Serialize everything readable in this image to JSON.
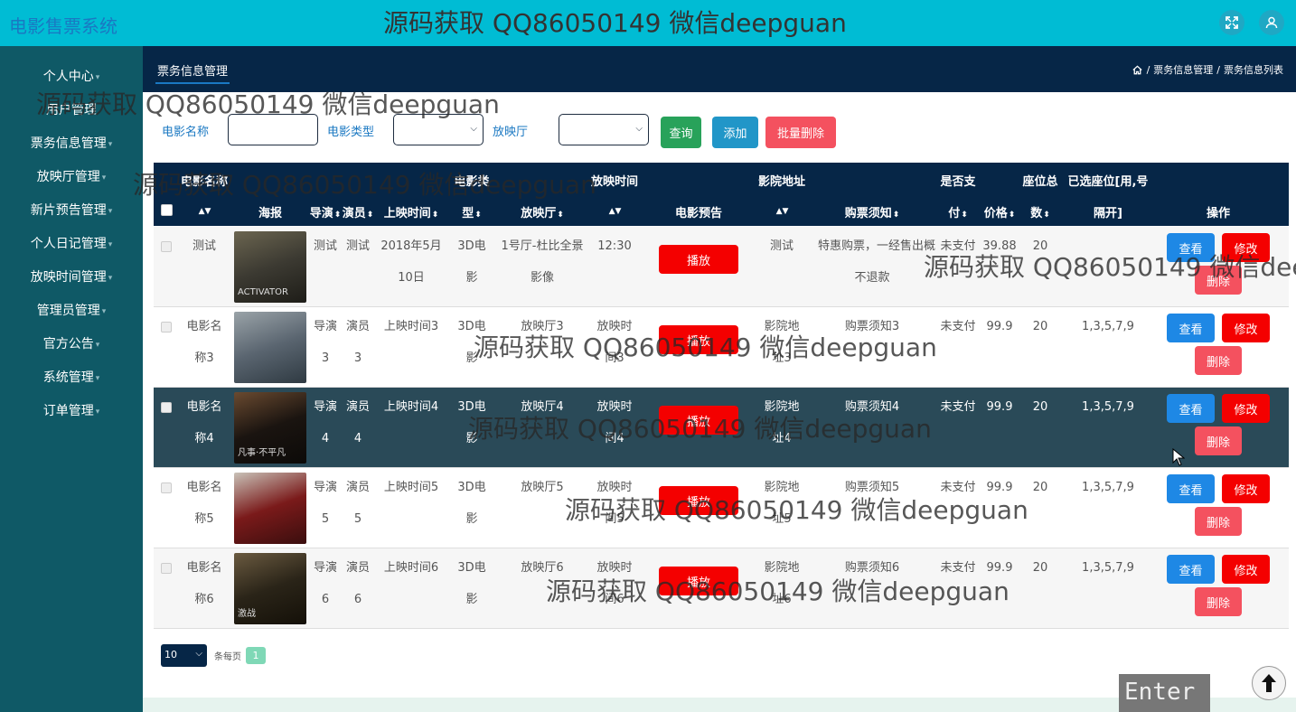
{
  "app": {
    "brand": "电影售票系统",
    "watermark": "源码获取 QQ86050149 微信deepguan"
  },
  "header_icons": [
    "fullscreen-icon",
    "user-icon"
  ],
  "sidebar": {
    "items": [
      "个人中心",
      "用户管理",
      "票务信息管理",
      "放映厅管理",
      "新片预告管理",
      "个人日记管理",
      "放映时间管理",
      "管理员管理",
      "官方公告",
      "系统管理",
      "订单管理"
    ]
  },
  "page": {
    "tab": "票务信息管理",
    "breadcrumb": {
      "sep": "/",
      "parts": [
        "票务信息管理",
        "票务信息列表"
      ]
    }
  },
  "search": {
    "movie_name_label": "电影名称",
    "movie_name_value": "",
    "movie_type_label": "电影类型",
    "hall_label": "放映厅",
    "query_btn": "查询",
    "add_btn": "添加",
    "batch_delete_btn": "批量删除"
  },
  "table": {
    "headers": {
      "name_top": "电影名称",
      "poster": "海报",
      "director": "导演",
      "actor": "演员",
      "release": "上映时间",
      "type_top": "电影类",
      "type_bottom": "型",
      "hall": "放映厅",
      "showtime": "放映时间",
      "trailer": "电影预告",
      "address": "影院地址",
      "notice": "购票须知",
      "paid_top": "是否支",
      "paid_bottom": "付",
      "price": "价格",
      "seats_top": "座位总",
      "seats_bottom": "数",
      "chosen_top": "已选座位[用,号",
      "chosen_bottom": "隔开]",
      "ops": "操作"
    },
    "play_label": "播放",
    "view_label": "查看",
    "edit_label": "修改",
    "delete_label": "删除",
    "rows": [
      {
        "name1": "测试",
        "name2": "",
        "director1": "测试",
        "director2": "",
        "actor1": "测试",
        "actor2": "",
        "release1": "2018年5月",
        "release2": "10日",
        "type1": "3D电",
        "type2": "影",
        "hall1": "1号厅-杜比全景",
        "hall2": "影像",
        "time1": "12:30",
        "time2": "",
        "addr1": "测试",
        "addr2": "",
        "notice1": "特惠购票，一经售出概",
        "notice2": "不退款",
        "paid": "未支付",
        "price": "39.88",
        "seats": "20",
        "chosen": "",
        "poster_text": "ACTIVATOR",
        "poster_colors": [
          "#3c3a32",
          "#6b6550",
          "#1e1d18"
        ],
        "selected": false
      },
      {
        "name1": "电影名",
        "name2": "称3",
        "director1": "导演",
        "director2": "3",
        "actor1": "演员",
        "actor2": "3",
        "release1": "上映时间3",
        "release2": "",
        "type1": "3D电",
        "type2": "影",
        "hall1": "放映厅3",
        "hall2": "",
        "time1": "放映时",
        "time2": "间3",
        "addr1": "影院地",
        "addr2": "址3",
        "notice1": "购票须知3",
        "notice2": "",
        "paid": "未支付",
        "price": "99.9",
        "seats": "20",
        "chosen": "1,3,5,7,9",
        "poster_text": "",
        "poster_colors": [
          "#5a6570",
          "#9aa3a8",
          "#2f3a42"
        ],
        "selected": false
      },
      {
        "name1": "电影名",
        "name2": "称4",
        "director1": "导演",
        "director2": "4",
        "actor1": "演员",
        "actor2": "4",
        "release1": "上映时间4",
        "release2": "",
        "type1": "3D电",
        "type2": "影",
        "hall1": "放映厅4",
        "hall2": "",
        "time1": "放映时",
        "time2": "间4",
        "addr1": "影院地",
        "addr2": "址4",
        "notice1": "购票须知4",
        "notice2": "",
        "paid": "未支付",
        "price": "99.9",
        "seats": "20",
        "chosen": "1,3,5,7,9",
        "poster_text": "凡事·不平凡",
        "poster_colors": [
          "#1a1410",
          "#6a4a30",
          "#0c0a08"
        ],
        "selected": true
      },
      {
        "name1": "电影名",
        "name2": "称5",
        "director1": "导演",
        "director2": "5",
        "actor1": "演员",
        "actor2": "5",
        "release1": "上映时间5",
        "release2": "",
        "type1": "3D电",
        "type2": "影",
        "hall1": "放映厅5",
        "hall2": "",
        "time1": "放映时",
        "time2": "间5",
        "addr1": "影院地",
        "addr2": "址5",
        "notice1": "购票须知5",
        "notice2": "",
        "paid": "未支付",
        "price": "99.9",
        "seats": "20",
        "chosen": "1,3,5,7,9",
        "poster_text": "",
        "poster_colors": [
          "#7a1a1a",
          "#c9c2b8",
          "#3a0e0e"
        ],
        "selected": false
      },
      {
        "name1": "电影名",
        "name2": "称6",
        "director1": "导演",
        "director2": "6",
        "actor1": "演员",
        "actor2": "6",
        "release1": "上映时间6",
        "release2": "",
        "type1": "3D电",
        "type2": "影",
        "hall1": "放映厅6",
        "hall2": "",
        "time1": "放映时",
        "time2": "间6",
        "addr1": "影院地",
        "addr2": "址6",
        "notice1": "购票须知6",
        "notice2": "",
        "paid": "未支付",
        "price": "99.9",
        "seats": "20",
        "chosen": "1,3,5,7,9",
        "poster_text": "激战",
        "poster_colors": [
          "#2a2418",
          "#6a5a40",
          "#141008"
        ],
        "selected": false
      }
    ]
  },
  "pagination": {
    "page_size": "10",
    "per_page_label": "条每页",
    "current_page": "1"
  },
  "overlay": {
    "enter_key": "Enter"
  },
  "colors": {
    "header": "#00bcd4",
    "sidebar": "#0f5966",
    "dark": "#062647",
    "view": "#1e88e5",
    "edit": "#f40000",
    "delete": "#f4515f",
    "query": "#28a25a",
    "add": "#2196c8"
  }
}
